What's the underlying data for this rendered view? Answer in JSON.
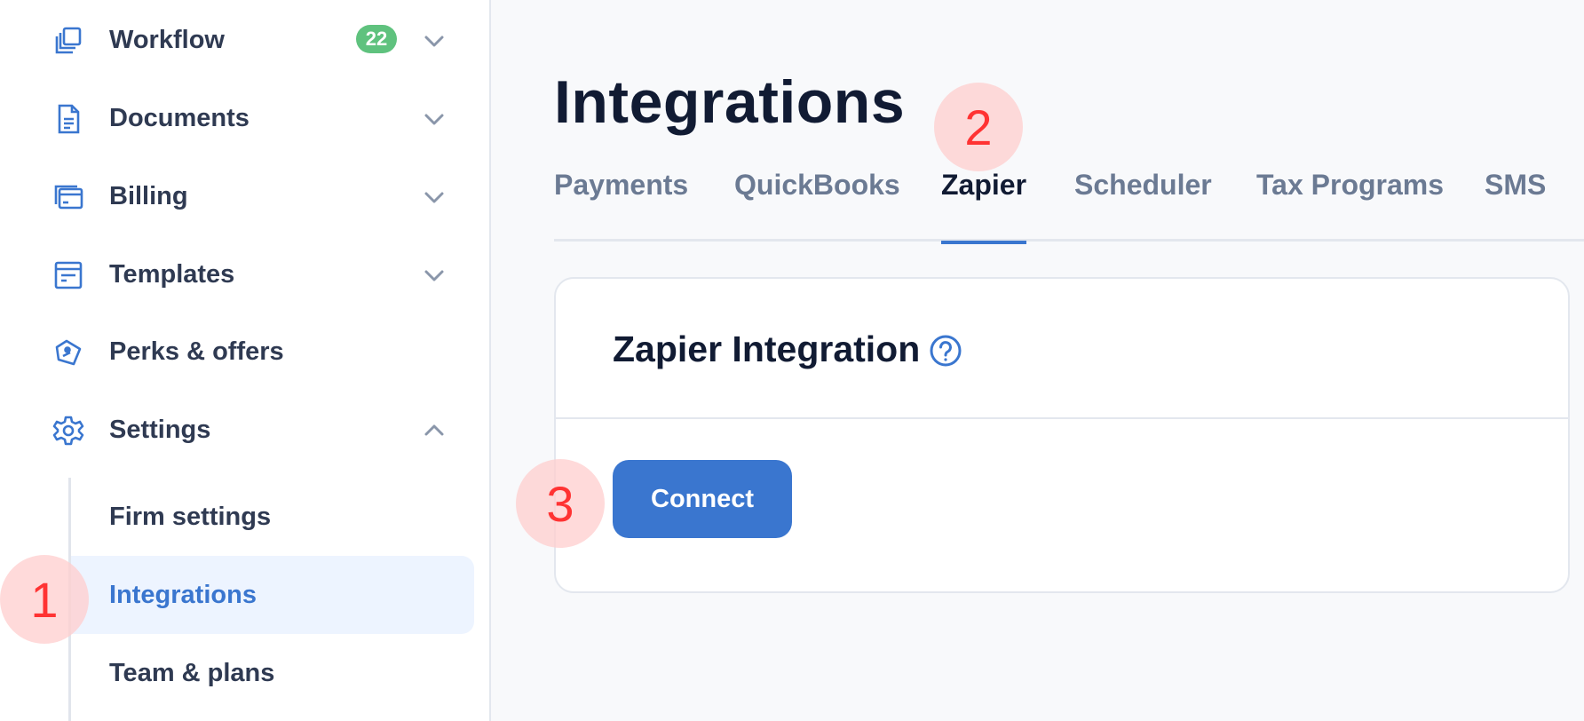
{
  "sidebar": {
    "items": [
      {
        "label": "Workflow",
        "icon": "copy-stack-icon",
        "badge": "22",
        "expandable": true
      },
      {
        "label": "Documents",
        "icon": "document-icon",
        "expandable": true
      },
      {
        "label": "Billing",
        "icon": "billing-card-icon",
        "expandable": true
      },
      {
        "label": "Templates",
        "icon": "template-icon",
        "expandable": true
      },
      {
        "label": "Perks & offers",
        "icon": "tag-icon",
        "expandable": false
      },
      {
        "label": "Settings",
        "icon": "gear-icon",
        "expandable": true,
        "expanded": true
      }
    ],
    "settings_sub": [
      {
        "label": "Firm settings"
      },
      {
        "label": "Integrations",
        "active": true
      },
      {
        "label": "Team & plans"
      }
    ]
  },
  "main": {
    "title": "Integrations",
    "tabs": [
      {
        "label": "Payments"
      },
      {
        "label": "QuickBooks"
      },
      {
        "label": "Zapier",
        "active": true
      },
      {
        "label": "Scheduler"
      },
      {
        "label": "Tax Programs"
      },
      {
        "label": "SMS"
      }
    ],
    "card": {
      "title": "Zapier Integration",
      "help_icon": "question-circle-icon",
      "connect_label": "Connect"
    }
  },
  "markers": [
    "1",
    "2",
    "3"
  ],
  "colors": {
    "accent": "#3a76cf",
    "badge": "#5fc27e",
    "marker_fill": "#ffcdcd",
    "marker_text": "#ff3333"
  }
}
